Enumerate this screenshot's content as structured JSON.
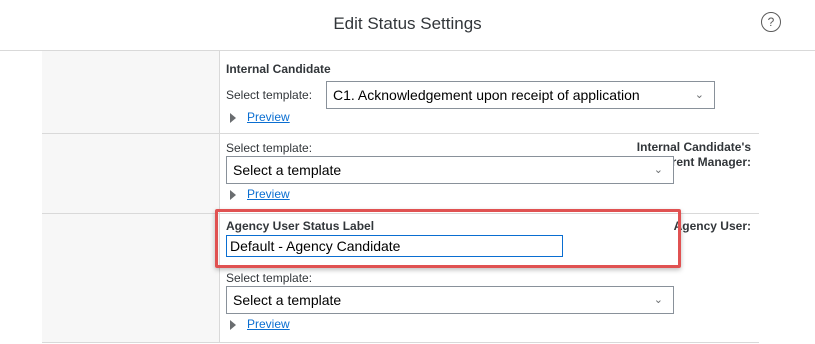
{
  "header": {
    "title": "Edit Status Settings",
    "help_icon": "?"
  },
  "sections": {
    "internal_candidate": {
      "heading": "Internal Candidate",
      "select_label": "Select template:",
      "select_value": "C1. Acknowledgement upon receipt of application",
      "preview_label": "Preview"
    },
    "manager": {
      "label_line1": "Internal Candidate's",
      "label_line2": "Current Manager:",
      "select_label": "Select template:",
      "select_value": "Select a template",
      "preview_label": "Preview"
    },
    "agency": {
      "label": "Agency User:",
      "status_heading": "Agency User Status Label",
      "status_value": "Default - Agency Candidate",
      "select_label": "Select template:",
      "select_value": "Select a template",
      "preview_label": "Preview"
    }
  },
  "icons": {
    "chevron": "⌄",
    "highlight_color": "#e05252"
  }
}
